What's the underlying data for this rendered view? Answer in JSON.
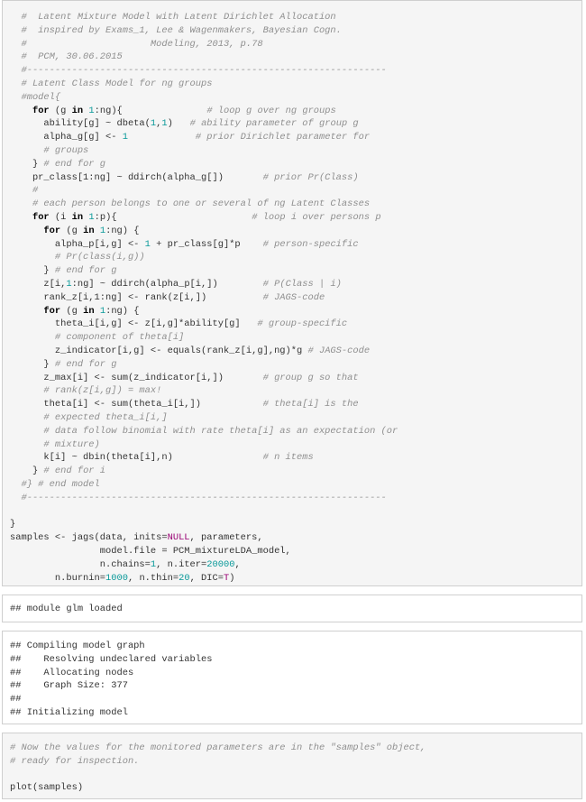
{
  "code_block_1": {
    "lines": [
      [
        {
          "t": "  #  Latent Mixture Model with Latent Dirichlet Allocation",
          "c": "c"
        }
      ],
      [
        {
          "t": "  #  inspired by Exams_1, Lee & Wagenmakers, Bayesian Cogn.",
          "c": "c"
        }
      ],
      [
        {
          "t": "  #                      Modeling, 2013, p.78",
          "c": "c"
        }
      ],
      [
        {
          "t": "  #  PCM, 30.06.2015",
          "c": "c"
        }
      ],
      [
        {
          "t": "  #----------------------------------------------------------------",
          "c": "c"
        }
      ],
      [
        {
          "t": "  # Latent Class Model for ng groups",
          "c": "c"
        }
      ],
      [
        {
          "t": "  #model{",
          "c": "c"
        }
      ],
      [
        {
          "t": "    "
        },
        {
          "t": "for",
          "c": "k"
        },
        {
          "t": " (g "
        },
        {
          "t": "in",
          "c": "k"
        },
        {
          "t": " "
        },
        {
          "t": "1",
          "c": "n"
        },
        {
          "t": ":ng){               "
        },
        {
          "t": "# loop g over ng groups",
          "c": "c"
        }
      ],
      [
        {
          "t": "      ability[g] ~ dbeta("
        },
        {
          "t": "1",
          "c": "n"
        },
        {
          "t": ","
        },
        {
          "t": "1",
          "c": "n"
        },
        {
          "t": ")   "
        },
        {
          "t": "# ability parameter of group g",
          "c": "c"
        }
      ],
      [
        {
          "t": "      alpha_g[g] <- "
        },
        {
          "t": "1",
          "c": "n"
        },
        {
          "t": "            "
        },
        {
          "t": "# prior Dirichlet parameter for",
          "c": "c"
        }
      ],
      [
        {
          "t": "      # groups",
          "c": "c"
        }
      ],
      [
        {
          "t": "    } "
        },
        {
          "t": "# end for g",
          "c": "c"
        }
      ],
      [
        {
          "t": "    pr_class[1:ng] ~ ddirch(alpha_g[])       "
        },
        {
          "t": "# prior Pr(Class)",
          "c": "c"
        }
      ],
      [
        {
          "t": "    #",
          "c": "c"
        }
      ],
      [
        {
          "t": "    # each person belongs to one or several of ng Latent Classes",
          "c": "c"
        }
      ],
      [
        {
          "t": "    "
        },
        {
          "t": "for",
          "c": "k"
        },
        {
          "t": " (i "
        },
        {
          "t": "in",
          "c": "k"
        },
        {
          "t": " "
        },
        {
          "t": "1",
          "c": "n"
        },
        {
          "t": ":p){                        "
        },
        {
          "t": "# loop i over persons p",
          "c": "c"
        }
      ],
      [
        {
          "t": "      "
        },
        {
          "t": "for",
          "c": "k"
        },
        {
          "t": " (g "
        },
        {
          "t": "in",
          "c": "k"
        },
        {
          "t": " "
        },
        {
          "t": "1",
          "c": "n"
        },
        {
          "t": ":ng) {"
        }
      ],
      [
        {
          "t": "        alpha_p[i,g] <- "
        },
        {
          "t": "1",
          "c": "n"
        },
        {
          "t": " + pr_class[g]*p    "
        },
        {
          "t": "# person-specific",
          "c": "c"
        }
      ],
      [
        {
          "t": "        # Pr(class(i,g))",
          "c": "c"
        }
      ],
      [
        {
          "t": "      } "
        },
        {
          "t": "# end for g",
          "c": "c"
        }
      ],
      [
        {
          "t": "      z[i,"
        },
        {
          "t": "1",
          "c": "n"
        },
        {
          "t": ":ng] ~ ddirch(alpha_p[i,])        "
        },
        {
          "t": "# P(Class | i)",
          "c": "c"
        }
      ],
      [
        {
          "t": "      rank_z[i,1:ng] <- rank(z[i,])          "
        },
        {
          "t": "# JAGS-code",
          "c": "c"
        }
      ],
      [
        {
          "t": "      "
        },
        {
          "t": "for",
          "c": "k"
        },
        {
          "t": " (g "
        },
        {
          "t": "in",
          "c": "k"
        },
        {
          "t": " "
        },
        {
          "t": "1",
          "c": "n"
        },
        {
          "t": ":ng) {"
        }
      ],
      [
        {
          "t": "        theta_i[i,g] <- z[i,g]*ability[g]   "
        },
        {
          "t": "# group-specific",
          "c": "c"
        }
      ],
      [
        {
          "t": "        # component of theta[i]",
          "c": "c"
        }
      ],
      [
        {
          "t": "        z_indicator[i,g] <- equals(rank_z[i,g],ng)*g "
        },
        {
          "t": "# JAGS-code",
          "c": "c"
        }
      ],
      [
        {
          "t": "      } "
        },
        {
          "t": "# end for g",
          "c": "c"
        }
      ],
      [
        {
          "t": "      z_max[i] <- sum(z_indicator[i,])       "
        },
        {
          "t": "# group g so that",
          "c": "c"
        }
      ],
      [
        {
          "t": "      # rank(z[i,g]) = max!",
          "c": "c"
        }
      ],
      [
        {
          "t": "      theta[i] <- sum(theta_i[i,])           "
        },
        {
          "t": "# theta[i] is the",
          "c": "c"
        }
      ],
      [
        {
          "t": "      # expected theta_i[i,]",
          "c": "c"
        }
      ],
      [
        {
          "t": "      # data follow binomial with rate theta[i] as an expectation (or",
          "c": "c"
        }
      ],
      [
        {
          "t": "      # mixture)",
          "c": "c"
        }
      ],
      [
        {
          "t": "      k[i] ~ dbin(theta[i],n)                "
        },
        {
          "t": "# n items",
          "c": "c"
        }
      ],
      [
        {
          "t": "    } "
        },
        {
          "t": "# end for i",
          "c": "c"
        }
      ],
      [
        {
          "t": "  #} # end model",
          "c": "c"
        }
      ],
      [
        {
          "t": "  #----------------------------------------------------------------",
          "c": "c"
        }
      ],
      [
        {
          "t": ""
        }
      ],
      [
        {
          "t": "}"
        }
      ],
      [
        {
          "t": "samples <- jags(data, inits="
        },
        {
          "t": "NULL",
          "c": "p"
        },
        {
          "t": ", parameters,"
        }
      ],
      [
        {
          "t": "                model.file = PCM_mixtureLDA_model,"
        }
      ],
      [
        {
          "t": "                n.chains="
        },
        {
          "t": "1",
          "c": "n"
        },
        {
          "t": ", n.iter="
        },
        {
          "t": "20000",
          "c": "n"
        },
        {
          "t": ","
        }
      ],
      [
        {
          "t": "        n.burnin="
        },
        {
          "t": "1000",
          "c": "n"
        },
        {
          "t": ", n.thin="
        },
        {
          "t": "20",
          "c": "n"
        },
        {
          "t": ", DIC="
        },
        {
          "t": "T",
          "c": "p"
        },
        {
          "t": ")"
        }
      ]
    ]
  },
  "output_block_1": {
    "lines": [
      [
        {
          "t": "## module glm loaded"
        }
      ]
    ]
  },
  "output_block_2": {
    "lines": [
      [
        {
          "t": "## Compiling model graph"
        }
      ],
      [
        {
          "t": "##    Resolving undeclared variables"
        }
      ],
      [
        {
          "t": "##    Allocating nodes"
        }
      ],
      [
        {
          "t": "##    Graph Size: 377"
        }
      ],
      [
        {
          "t": "##"
        }
      ],
      [
        {
          "t": "## Initializing model"
        }
      ]
    ]
  },
  "code_block_2": {
    "lines": [
      [
        {
          "t": "# Now the values for the monitored parameters are in the \"samples\" object,",
          "c": "c"
        }
      ],
      [
        {
          "t": "# ready for inspection.",
          "c": "c"
        }
      ],
      [
        {
          "t": ""
        }
      ],
      [
        {
          "t": "plot(samples)"
        }
      ]
    ]
  }
}
